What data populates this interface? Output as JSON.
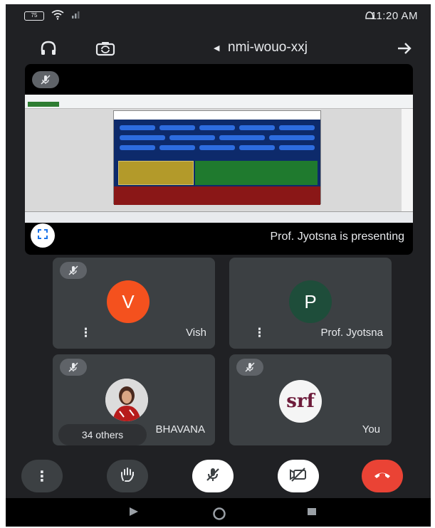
{
  "status_bar": {
    "time": "11:20 AM",
    "battery": "75"
  },
  "meeting": {
    "code": "nmi-wouo-xxj"
  },
  "presentation": {
    "presenting_text": "Prof. Jyotsna is presenting"
  },
  "participants": [
    {
      "name": "Vish",
      "initial": "V",
      "avatar_color": "#f4511e"
    },
    {
      "name": "Prof. Jyotsna",
      "initial": "P",
      "avatar_color": "#1e4d3a"
    },
    {
      "name": "BHAVANA",
      "avatar_kind": "photo"
    },
    {
      "name": "You",
      "avatar_logo": "srf"
    }
  ],
  "others_chip": "34 others",
  "controls": {
    "end_call_color": "#ea4335"
  },
  "icons": {
    "headphones": "headphones-icon",
    "switch_camera": "switch-camera-icon",
    "back_arrow": "arrow-icon",
    "mic_off": "mic-off-icon",
    "fullscreen": "fullscreen-icon",
    "more": "more-vert-icon",
    "raise_hand": "hand-icon",
    "camera_off": "camera-off-icon",
    "end_call": "end-call-icon"
  }
}
